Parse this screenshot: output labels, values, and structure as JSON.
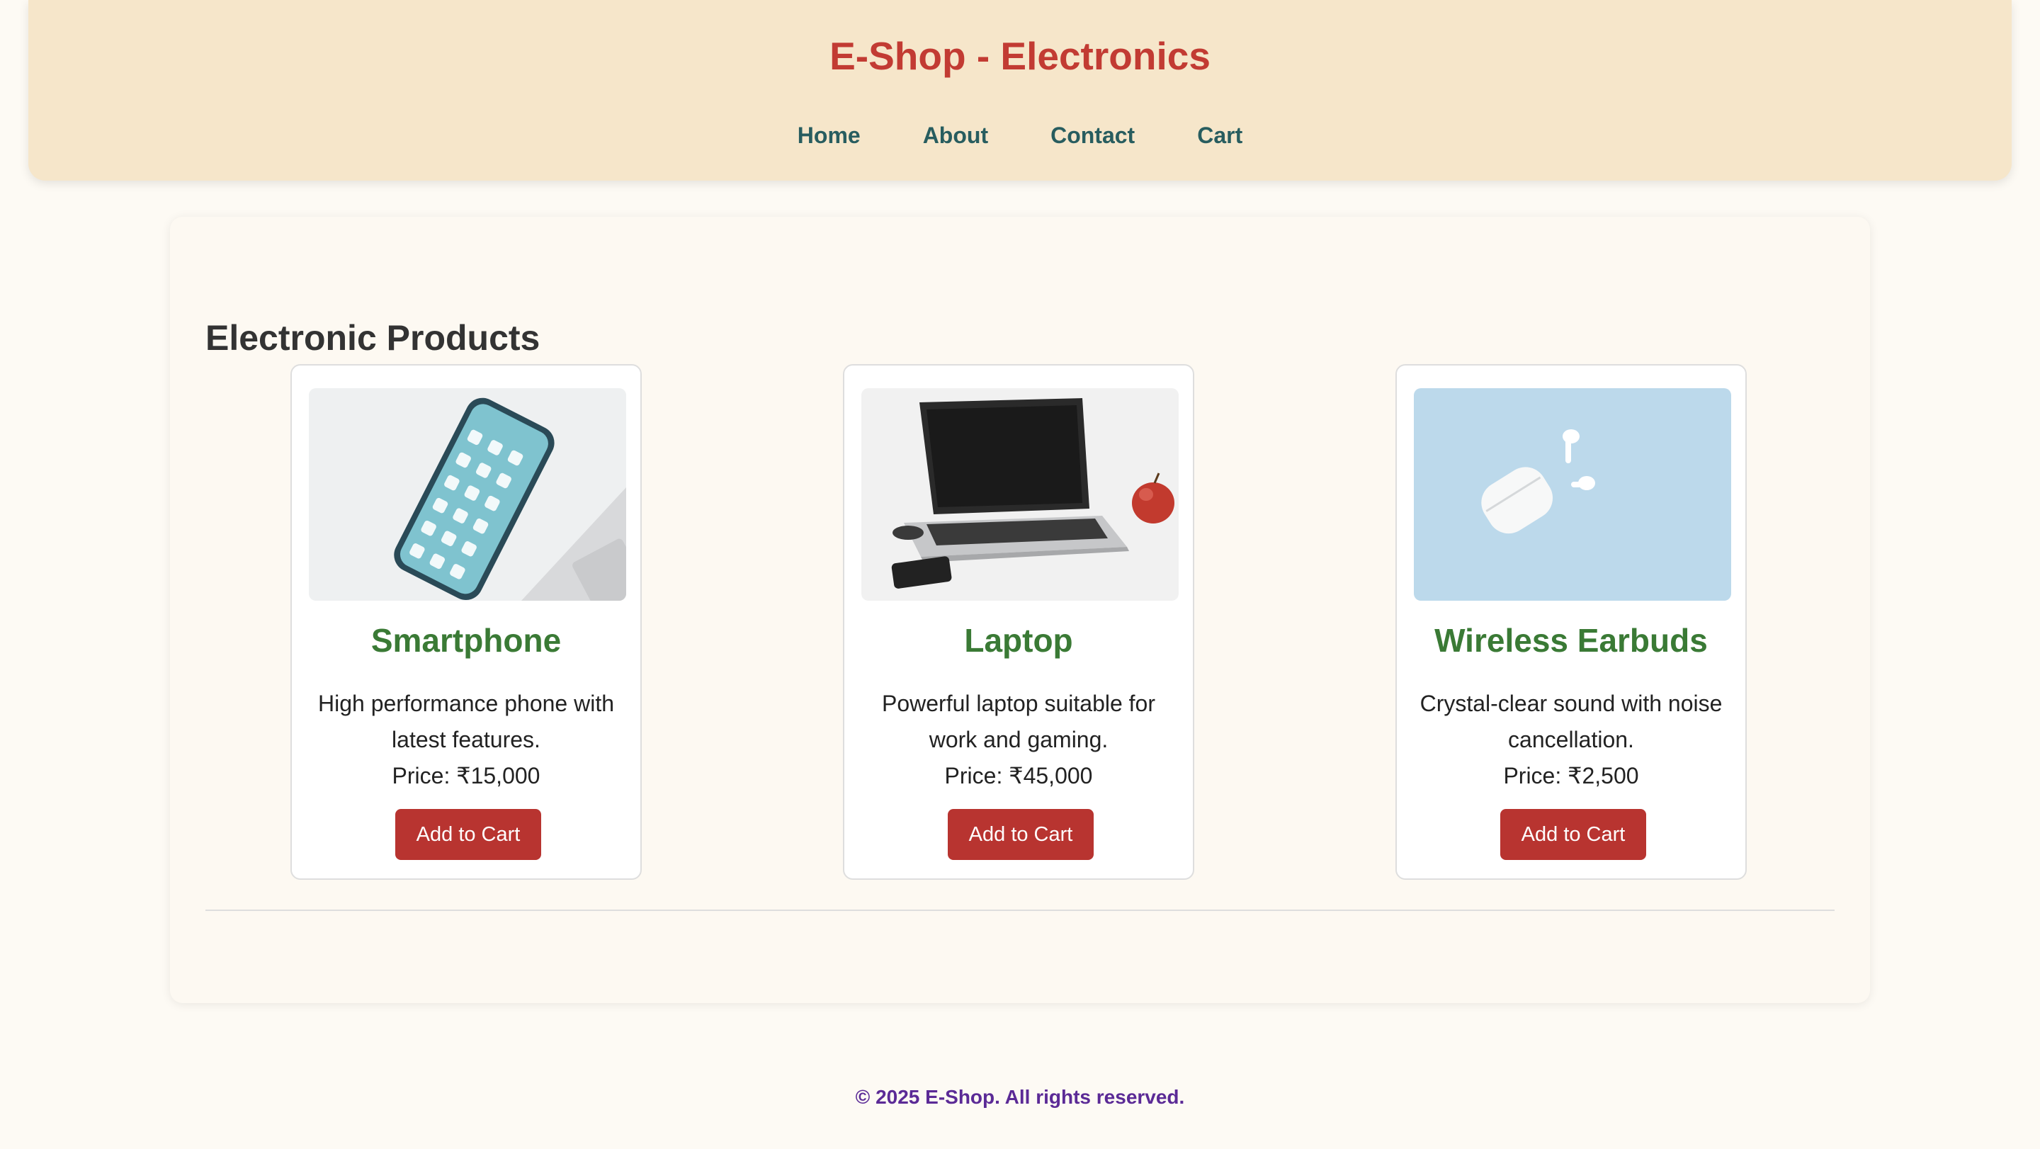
{
  "header": {
    "title": "E-Shop - Electronics",
    "nav": [
      {
        "label": "Home"
      },
      {
        "label": "About"
      },
      {
        "label": "Contact"
      },
      {
        "label": "Cart"
      }
    ]
  },
  "main": {
    "section_title": "Electronic Products",
    "products": [
      {
        "name": "Smartphone",
        "description": "High performance phone with latest features.",
        "price": "Price: ₹15,000",
        "button_label": "Add to Cart",
        "image_icon": "smartphone-image"
      },
      {
        "name": "Laptop",
        "description": "Powerful laptop suitable for work and gaming.",
        "price": "Price: ₹45,000",
        "button_label": "Add to Cart",
        "image_icon": "laptop-image"
      },
      {
        "name": "Wireless Earbuds",
        "description": "Crystal-clear sound with noise cancellation.",
        "price": "Price: ₹2,500",
        "button_label": "Add to Cart",
        "image_icon": "earbuds-image"
      }
    ]
  },
  "footer": {
    "text": "© 2025 E-Shop. All rights reserved."
  },
  "colors": {
    "header_bg": "#f6e6ca",
    "title": "#c23b33",
    "nav_link": "#285d5f",
    "product_name": "#3a7a35",
    "button": "#b83430",
    "footer_text": "#5b2a96"
  }
}
